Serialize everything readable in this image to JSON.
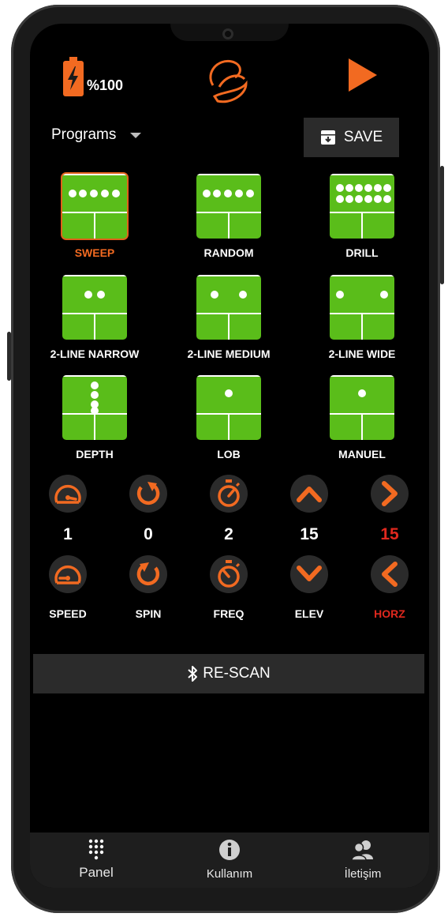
{
  "status": {
    "battery_text": "%100"
  },
  "header": {
    "programs_label": "Programs",
    "save_label": "SAVE"
  },
  "programs": [
    {
      "label": "SWEEP",
      "selected": true
    },
    {
      "label": "RANDOM"
    },
    {
      "label": "DRILL"
    },
    {
      "label": "2-LINE NARROW"
    },
    {
      "label": "2-LINE MEDIUM"
    },
    {
      "label": "2-LINE WIDE"
    },
    {
      "label": "DEPTH"
    },
    {
      "label": "LOB"
    },
    {
      "label": "MANUEL"
    }
  ],
  "controls": [
    {
      "label": "SPEED",
      "value": "1"
    },
    {
      "label": "SPIN",
      "value": "0"
    },
    {
      "label": "FREQ",
      "value": "2"
    },
    {
      "label": "ELEV",
      "value": "15"
    },
    {
      "label": "HORZ",
      "value": "15"
    }
  ],
  "rescan_label": "RE-SCAN",
  "nav": [
    {
      "label": "Panel",
      "icon": "keypad-icon"
    },
    {
      "label": "Kullanım",
      "icon": "info-icon"
    },
    {
      "label": "İletişim",
      "icon": "contacts-icon"
    }
  ],
  "colors": {
    "accent": "#f26a21",
    "court": "#5abd1a",
    "alert": "#e0281e"
  }
}
